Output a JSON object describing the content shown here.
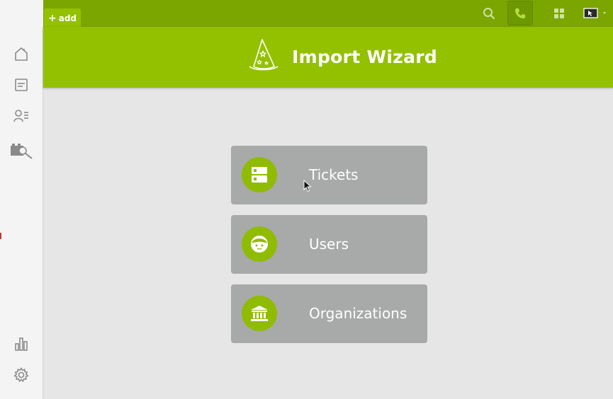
{
  "topbar": {
    "add_label": "add",
    "icons": [
      "search-icon",
      "phone-icon",
      "apps-grid-icon",
      "monitor-icon"
    ]
  },
  "sidebar": {
    "items": [
      "home-icon",
      "overview-icon",
      "customers-icon",
      "tools-icon"
    ],
    "bottom": [
      "reports-icon",
      "settings-icon"
    ]
  },
  "header": {
    "title": "Import Wizard",
    "icon": "wizard-hat-icon"
  },
  "options": [
    {
      "label": "Tickets",
      "icon": "ticket-icon"
    },
    {
      "label": "Users",
      "icon": "user-face-icon"
    },
    {
      "label": "Organizations",
      "icon": "building-icon"
    }
  ],
  "colors": {
    "topbar": "#7ba600",
    "header": "#93c100",
    "card": "#a8a9a9",
    "icon_circle": "#8fbc00"
  }
}
